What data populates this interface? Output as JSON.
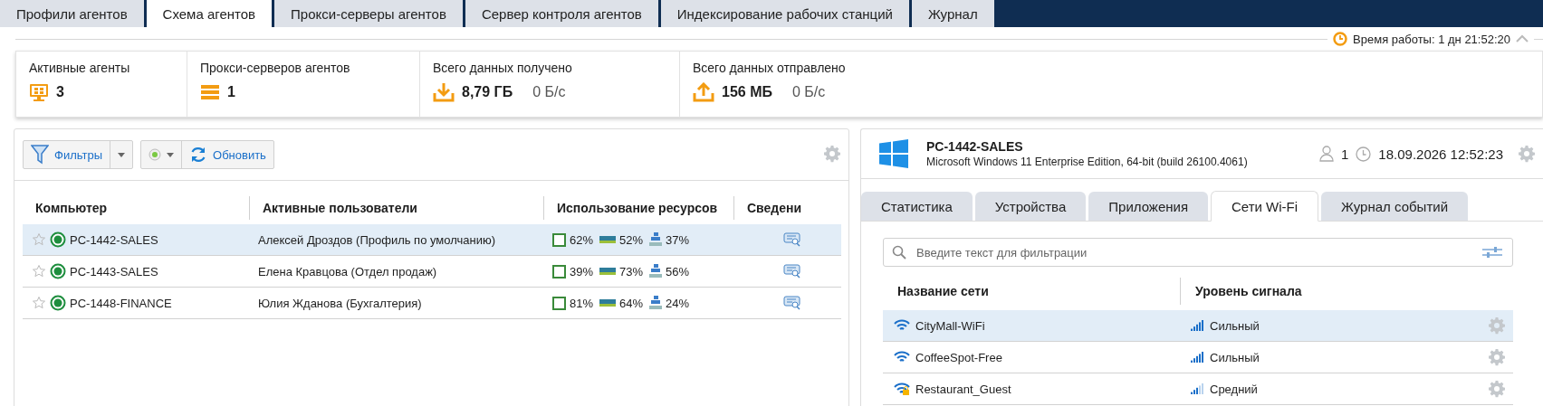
{
  "top_tabs": [
    {
      "label": "Профили агентов",
      "selected": false
    },
    {
      "label": "Схема агентов",
      "selected": true
    },
    {
      "label": "Прокси-серверы агентов",
      "selected": false
    },
    {
      "label": "Сервер контроля агентов",
      "selected": false
    },
    {
      "label": "Индексирование рабочих станций",
      "selected": false
    },
    {
      "label": "Журнал",
      "selected": false
    }
  ],
  "uptime": "Время работы: 1 дн 21:52:20",
  "stats": [
    {
      "kind": "agents",
      "title": "Активные агенты",
      "value": "3"
    },
    {
      "kind": "proxies",
      "title": "Прокси-серверов агентов",
      "value": "1"
    },
    {
      "kind": "received",
      "title": "Всего данных получено",
      "value": "8,79 ГБ",
      "rate": "0 Б/с"
    },
    {
      "kind": "sent",
      "title": "Всего данных отправлено",
      "value": "156 МБ",
      "rate": "0 Б/с"
    }
  ],
  "agents_panel": {
    "toolbar": {
      "filters": "Фильтры",
      "refresh": "Обновить"
    },
    "table": {
      "columns": [
        "Компьютер",
        "Активные пользователи",
        "Использование ресурсов",
        "Сведени"
      ],
      "rows": [
        {
          "computer": "PC-1442-SALES",
          "user": "Алексей Дроздов (Профиль по умолчанию)",
          "cpu": "62%",
          "ram": "52%",
          "disk": "37%",
          "selected": true,
          "favorite": false,
          "online": true
        },
        {
          "computer": "PC-1443-SALES",
          "user": "Елена Кравцова (Отдел продаж)",
          "cpu": "39%",
          "ram": "73%",
          "disk": "56%",
          "selected": false,
          "favorite": false,
          "online": true
        },
        {
          "computer": "PC-1448-FINANCE",
          "user": "Юлия Жданова (Бухгалтерия)",
          "cpu": "81%",
          "ram": "64%",
          "disk": "24%",
          "selected": false,
          "favorite": false,
          "online": true
        }
      ]
    }
  },
  "details": {
    "computer": "PC-1442-SALES",
    "os": "Microsoft Windows 11 Enterprise Edition, 64-bit (build 26100.4061)",
    "users": "1",
    "time": "18.09.2026 12:52:23",
    "tabs": [
      {
        "label": "Статистика",
        "selected": false
      },
      {
        "label": "Устройства",
        "selected": false
      },
      {
        "label": "Приложения",
        "selected": false
      },
      {
        "label": "Сети Wi-Fi",
        "selected": true
      },
      {
        "label": "Журнал событий",
        "selected": false
      }
    ],
    "search": {
      "placeholder": "Введите текст для фильтрации"
    },
    "table": {
      "columns": [
        "Название сети",
        "Уровень сигнала"
      ],
      "rows": [
        {
          "network": "CityMall-WiFi",
          "signal": "Сильный",
          "kind": "strong",
          "secured": false,
          "selected": true
        },
        {
          "network": "CoffeeSpot-Free",
          "signal": "Сильный",
          "kind": "strong",
          "secured": false,
          "selected": false
        },
        {
          "network": "Restaurant_Guest",
          "signal": "Средний",
          "kind": "medium",
          "secured": true,
          "selected": false
        }
      ]
    }
  }
}
